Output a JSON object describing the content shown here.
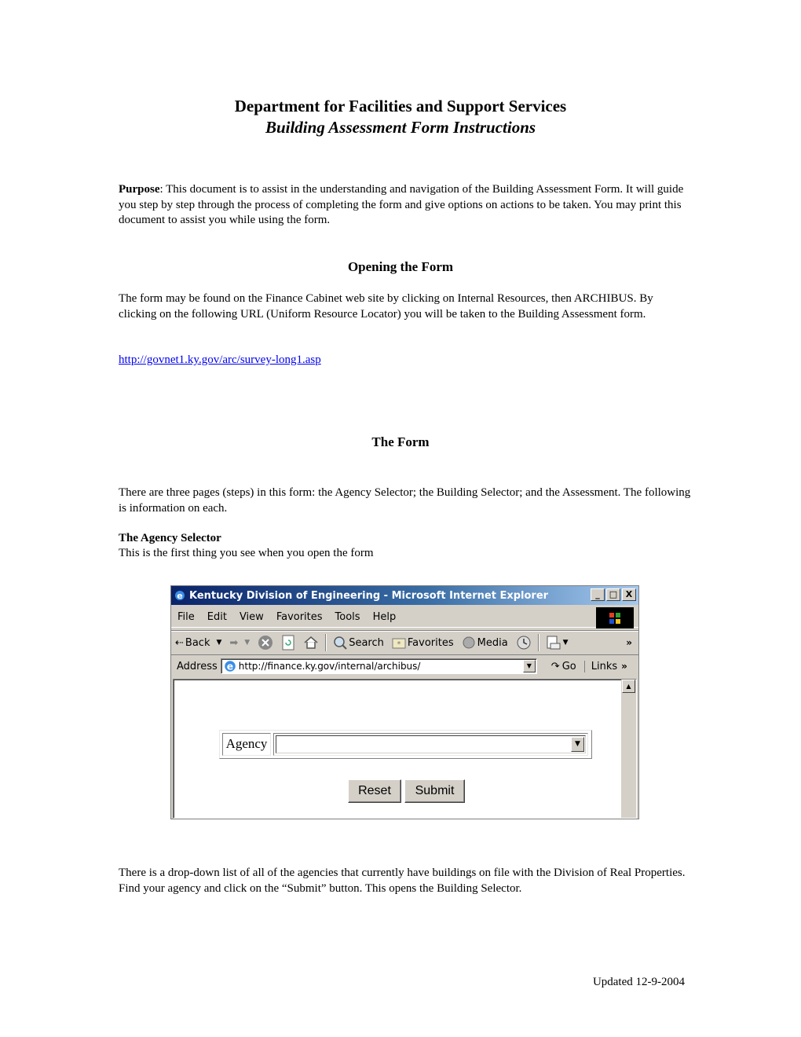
{
  "document": {
    "title_line1": "Department for Facilities and Support Services",
    "title_line2": "Building Assessment Form Instructions",
    "purpose_label": "Purpose",
    "purpose_text": ":  This document is to assist in the understanding and navigation of the Building Assessment Form. It will guide you step by step through the process of completing the form and give options on actions to be taken.  You may print this document to assist you while using the form.",
    "section_opening": {
      "heading": "Opening the Form",
      "text": "The form may be found on the Finance Cabinet web site by clicking on Internal Resources, then ARCHIBUS.  By clicking on the following URL (Uniform Resource Locator) you will be taken to the Building Assessment form.",
      "link": "http://govnet1.ky.gov/arc/survey-long1.asp"
    },
    "section_form": {
      "heading": "The Form",
      "text": "There are three pages (steps) in this form: the Agency Selector; the Building Selector; and the Assessment. The following is information on each.",
      "subheading": "The Agency Selector",
      "subtext": "This is the first thing you see when you open the form",
      "after_text": "There is a drop-down list of all of the agencies that currently have buildings on file with the Division of Real Properties. Find your agency and click on the “Submit” button.  This opens the Building Selector."
    },
    "footer": "Updated 12-9-2004"
  },
  "browser": {
    "window_title": "Kentucky Division of Engineering - Microsoft Internet Explorer",
    "window_buttons": [
      "_",
      "□",
      "X"
    ],
    "menu": [
      "File",
      "Edit",
      "View",
      "Favorites",
      "Tools",
      "Help"
    ],
    "toolbar": {
      "back": "Back",
      "search": "Search",
      "favorites": "Favorites",
      "media": "Media",
      "more": "»"
    },
    "address": {
      "label": "Address",
      "value": "http://finance.ky.gov/internal/archibus/",
      "go": "Go",
      "links": "Links"
    },
    "form": {
      "agency_label": "Agency",
      "agency_value": "",
      "reset": "Reset",
      "submit": "Submit"
    }
  },
  "colors": {
    "link": "#0000ee",
    "titlebar_start": "#0a246a",
    "titlebar_end": "#a6caf0",
    "chrome": "#d4d0c8"
  }
}
